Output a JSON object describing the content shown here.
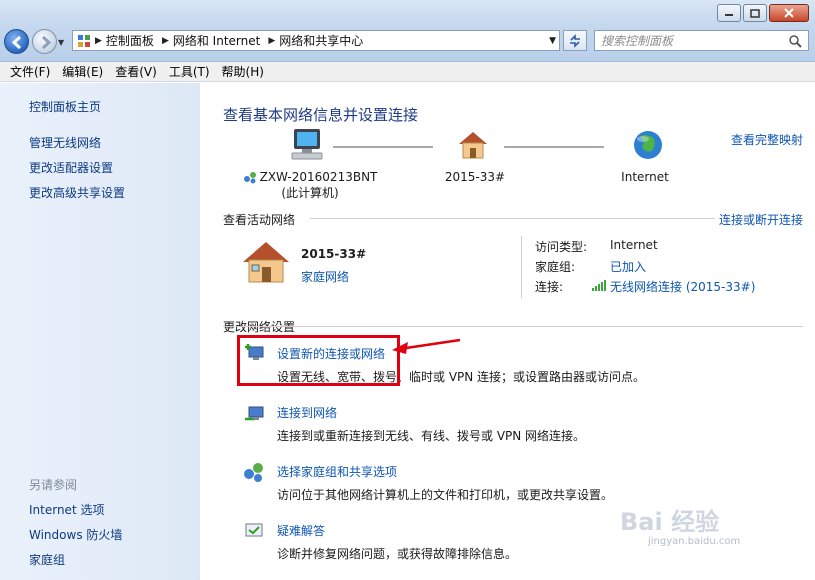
{
  "window": {
    "address": [
      "控制面板",
      "网络和 Internet",
      "网络和共享中心"
    ],
    "search_placeholder": "搜索控制面板"
  },
  "menu": [
    "文件(F)",
    "编辑(E)",
    "查看(V)",
    "工具(T)",
    "帮助(H)"
  ],
  "sidebar": {
    "top_links": [
      "控制面板主页",
      "管理无线网络",
      "更改适配器设置",
      "更改高级共享设置"
    ],
    "see_also_heading": "另请参阅",
    "see_also_links": [
      "Internet 选项",
      "Windows 防火墙",
      "家庭组"
    ]
  },
  "main": {
    "title": "查看基本网络信息并设置连接",
    "view_full_map": "查看完整映射",
    "nodes": {
      "computer_name": "ZXW-20160213BNT",
      "computer_sub": "(此计算机)",
      "network": "2015-33#",
      "internet": "Internet"
    },
    "active_section": "查看活动网络",
    "connect_disconnect": "连接或断开连接",
    "active_network": {
      "name": "2015-33#",
      "type": "家庭网络",
      "access_type_label": "访问类型:",
      "access_type_value": "Internet",
      "homegroup_label": "家庭组:",
      "homegroup_value": "已加入",
      "connection_label": "连接:",
      "connection_value": "无线网络连接 (2015-33#)"
    },
    "change_section": "更改网络设置",
    "tasks": [
      {
        "link": "设置新的连接或网络",
        "desc": "设置无线、宽带、拨号、临时或 VPN 连接；或设置路由器或访问点。"
      },
      {
        "link": "连接到网络",
        "desc": "连接到或重新连接到无线、有线、拨号或 VPN 网络连接。"
      },
      {
        "link": "选择家庭组和共享选项",
        "desc": "访问位于其他网络计算机上的文件和打印机，或更改共享设置。"
      },
      {
        "link": "疑难解答",
        "desc": "诊断并修复网络问题，或获得故障排除信息。"
      }
    ]
  },
  "watermark": {
    "main": "Bai 经验",
    "sub": "jingyan.baidu.com"
  },
  "colors": {
    "link": "#0e56b4",
    "title": "#1e3c87",
    "highlight": "#e00012"
  }
}
